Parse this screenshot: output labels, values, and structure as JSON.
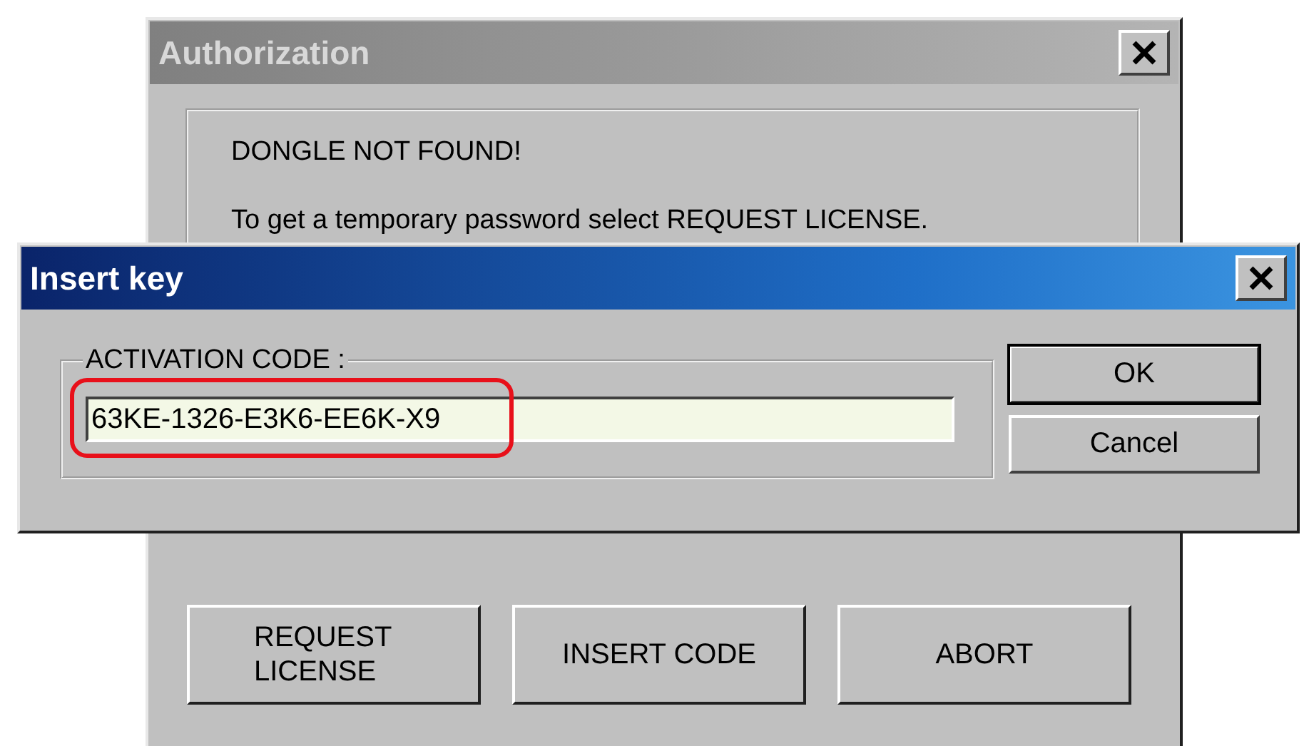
{
  "authorization_window": {
    "title": "Authorization",
    "active": false,
    "message": "DONGLE NOT FOUND!",
    "instruction": "To get a temporary password select REQUEST LICENSE.",
    "buttons": [
      {
        "label": "REQUEST LICENSE"
      },
      {
        "label": "INSERT CODE"
      },
      {
        "label": "ABORT"
      }
    ]
  },
  "insert_key_window": {
    "title": "Insert key",
    "active": true,
    "group_label": "ACTIVATION CODE :",
    "activation_code": {
      "value": "63KE-1326-E3K6-EE6K-X9",
      "highlighted": true
    },
    "buttons": [
      {
        "label": "OK",
        "default": true
      },
      {
        "label": "Cancel",
        "default": false
      }
    ]
  }
}
